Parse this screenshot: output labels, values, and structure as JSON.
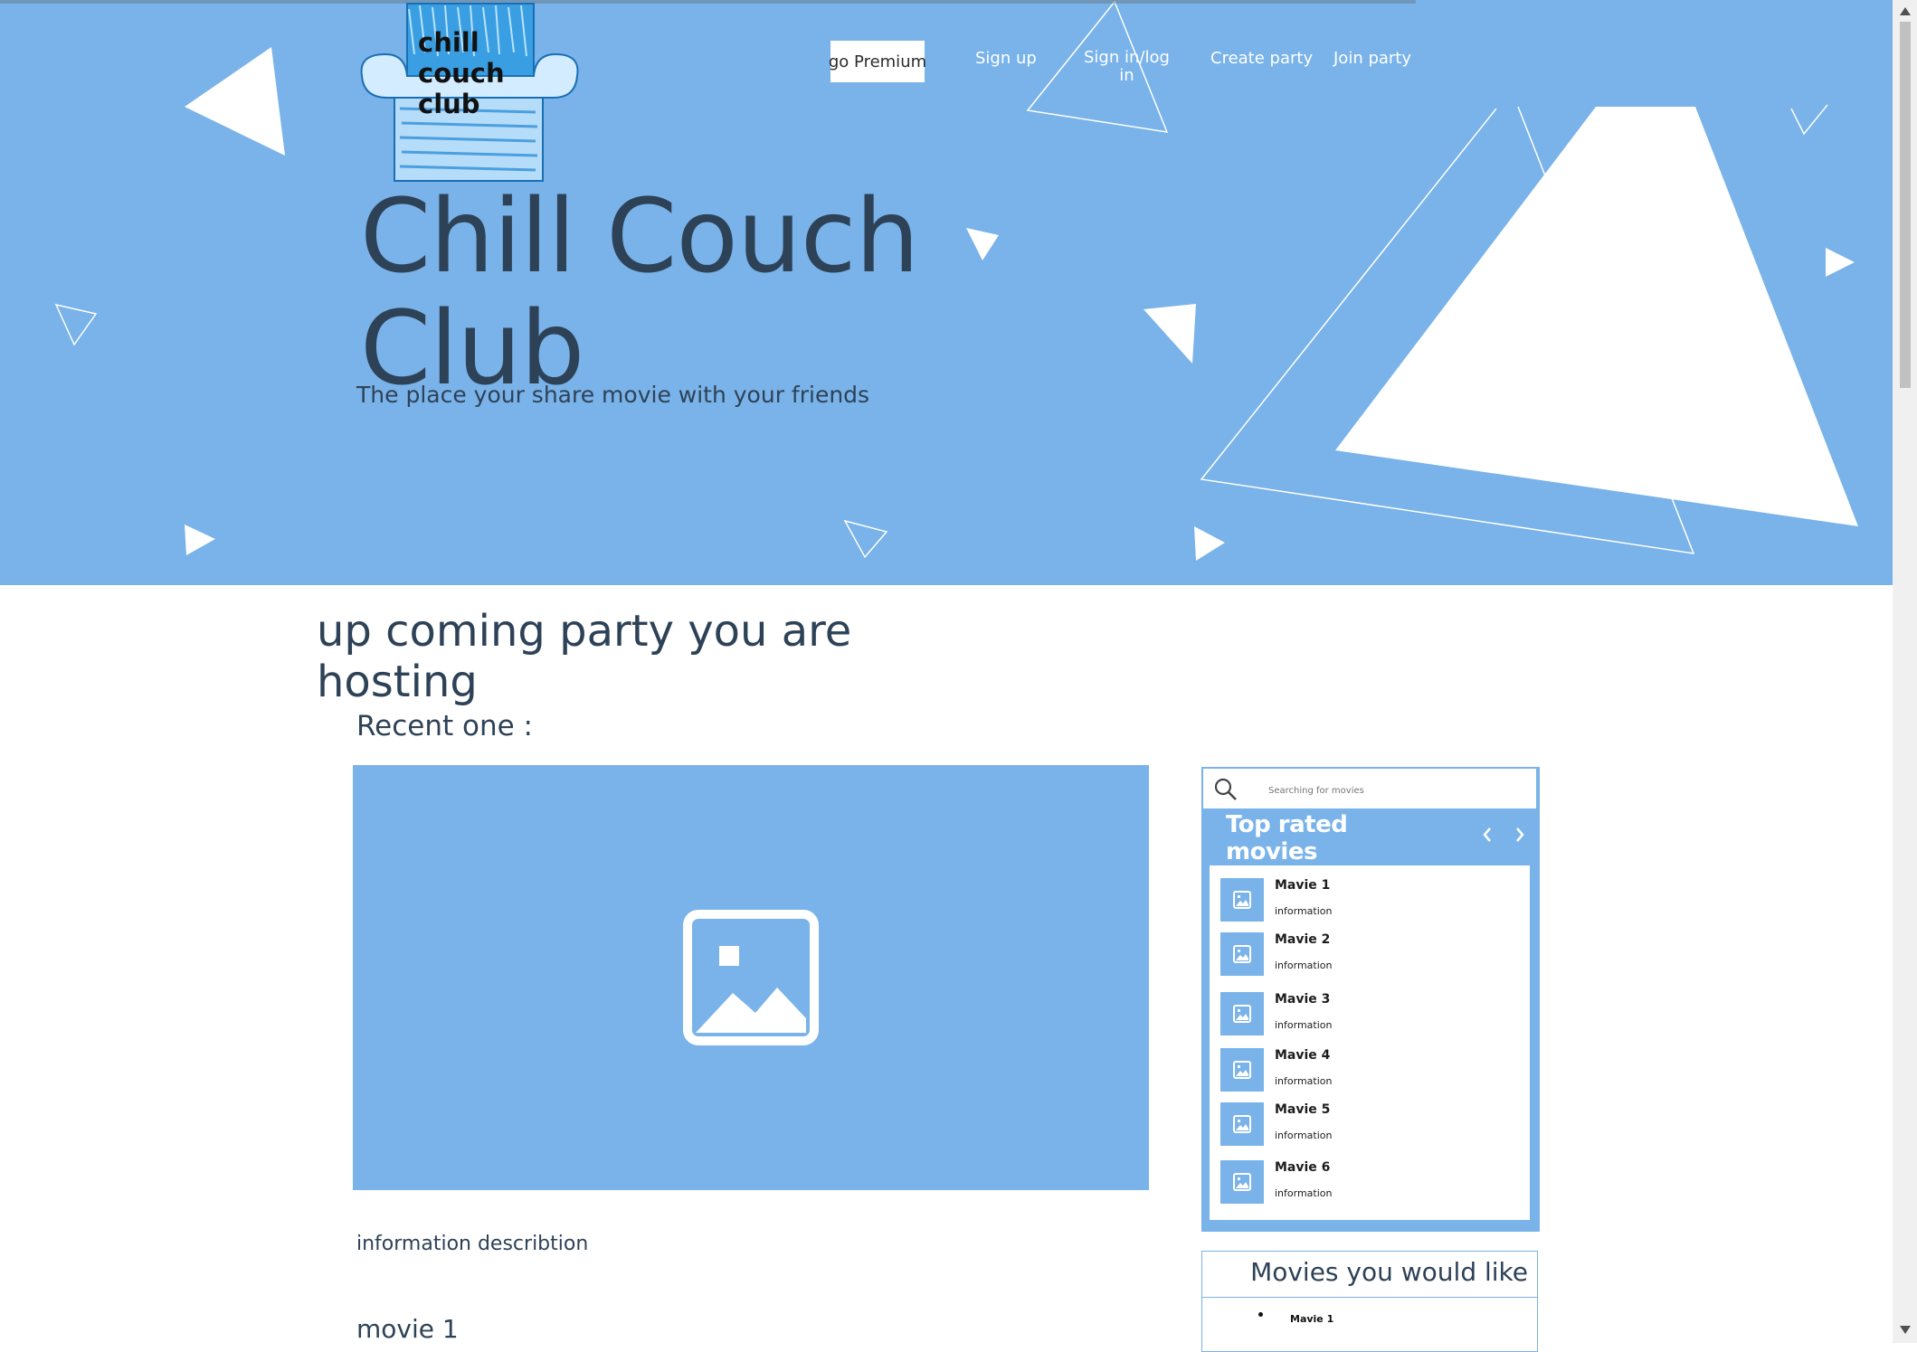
{
  "logo": {
    "text": "chill\ncouch\nclub"
  },
  "nav": {
    "premium": "go Premium",
    "sign_up": "Sign up",
    "sign_in": "Sign in/log\nin",
    "create_party": "Create party",
    "join_party": "Join party"
  },
  "hero": {
    "title": "Chill Couch Club",
    "subtitle": "The place your share movie with your friends"
  },
  "main": {
    "section_title": "up coming party you are hosting",
    "recent_label": "Recent one :",
    "info_description": "information describtion",
    "movie_label": "movie 1"
  },
  "sidebar": {
    "search_placeholder": "Searching for movies",
    "top_rated_title": "Top rated movies",
    "movies": [
      {
        "name": "Mavie 1",
        "info": "information"
      },
      {
        "name": "Mavie 2",
        "info": "information"
      },
      {
        "name": "Mavie 3",
        "info": "information"
      },
      {
        "name": "Mavie 4",
        "info": "information"
      },
      {
        "name": "Mavie 5",
        "info": "information"
      },
      {
        "name": "Mavie 6",
        "info": "information"
      }
    ],
    "like_title": "Movies you would like",
    "like_items": [
      "Mavie 1"
    ]
  },
  "colors": {
    "accent": "#79b3e9",
    "text": "#2e4257",
    "white": "#ffffff"
  }
}
